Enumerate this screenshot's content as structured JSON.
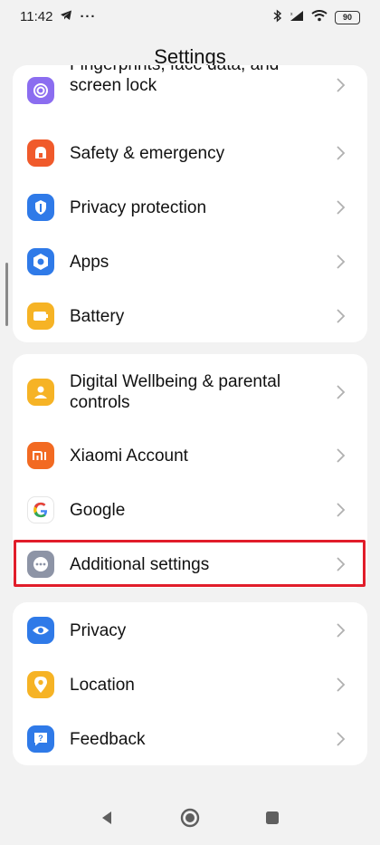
{
  "status_bar": {
    "time": "11:42",
    "more": "···",
    "battery": "90"
  },
  "header": {
    "title": "Settings"
  },
  "groups": [
    {
      "items": [
        {
          "label": "Fingerprints, face data, and\nscreen lock",
          "icon": "fingerprint-icon",
          "color": "#8b6df0",
          "partial": true
        },
        {
          "label": "Safety & emergency",
          "icon": "emergency-icon",
          "color": "#f05a2b"
        },
        {
          "label": "Privacy protection",
          "icon": "privacy-protection-icon",
          "color": "#2f7ae8"
        },
        {
          "label": "Apps",
          "icon": "apps-icon",
          "color": "#2f7ae8"
        },
        {
          "label": "Battery",
          "icon": "battery-icon",
          "color": "#f6b325"
        }
      ]
    },
    {
      "items": [
        {
          "label": "Digital Wellbeing & parental controls",
          "icon": "wellbeing-icon",
          "color": "#f6b325"
        },
        {
          "label": "Xiaomi Account",
          "icon": "xiaomi-icon",
          "color": "#f26a22"
        },
        {
          "label": "Google",
          "icon": "google-icon",
          "color": "#ffffff"
        },
        {
          "label": "Additional settings",
          "icon": "more-icon",
          "color": "#8d94a6",
          "highlighted": true
        }
      ]
    },
    {
      "items": [
        {
          "label": "Privacy",
          "icon": "eye-icon",
          "color": "#2f7ae8"
        },
        {
          "label": "Location",
          "icon": "location-icon",
          "color": "#f6b325"
        },
        {
          "label": "Feedback",
          "icon": "feedback-icon",
          "color": "#2f7ae8"
        }
      ]
    }
  ],
  "highlight_color": "#e11d2a"
}
